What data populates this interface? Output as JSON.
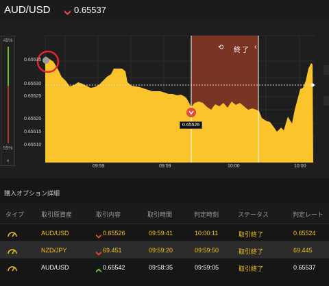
{
  "header": {
    "pair": "AUD/USD",
    "price": "0.65537",
    "direction": "down"
  },
  "gauge": {
    "top_pct": "45%",
    "bottom_pct": "55%",
    "close": "×"
  },
  "chart": {
    "y_labels": [
      "0.65535",
      "0.65530",
      "0.65525",
      "0.65520",
      "0.65515",
      "0.65510"
    ],
    "x_labels": [
      "09:59",
      "09:59",
      "10:00",
      "10:00"
    ],
    "end_label": "終了",
    "marker_price": "0.65526",
    "current_line": "0.65533",
    "colors": {
      "area": "#fcc42b",
      "end_zone": "#7a3424",
      "down": "#e24a3b",
      "up": "#6cbf2a"
    }
  },
  "details": {
    "title": "購入オプション詳細",
    "columns": [
      "タイプ",
      "取引原資産",
      "取引内容",
      "取引時間",
      "判定時刻",
      "ステータス",
      "判定レート"
    ],
    "rows": [
      {
        "asset": "AUD/USD",
        "dir": "down",
        "rate": "0.65526",
        "time": "09:59:41",
        "judge": "10:00:11",
        "status": "取引終了",
        "judge_rate": "0.65524",
        "color": "gold"
      },
      {
        "asset": "NZD/JPY",
        "dir": "down",
        "rate": "69.451",
        "time": "09:59:20",
        "judge": "09:59:50",
        "status": "取引終了",
        "judge_rate": "69.445",
        "color": "gold"
      },
      {
        "asset": "AUD/USD",
        "dir": "up",
        "rate": "0.65542",
        "time": "09:58:35",
        "judge": "09:59:05",
        "status": "取引終了",
        "judge_rate": "0.65537",
        "color": "white"
      }
    ]
  }
}
